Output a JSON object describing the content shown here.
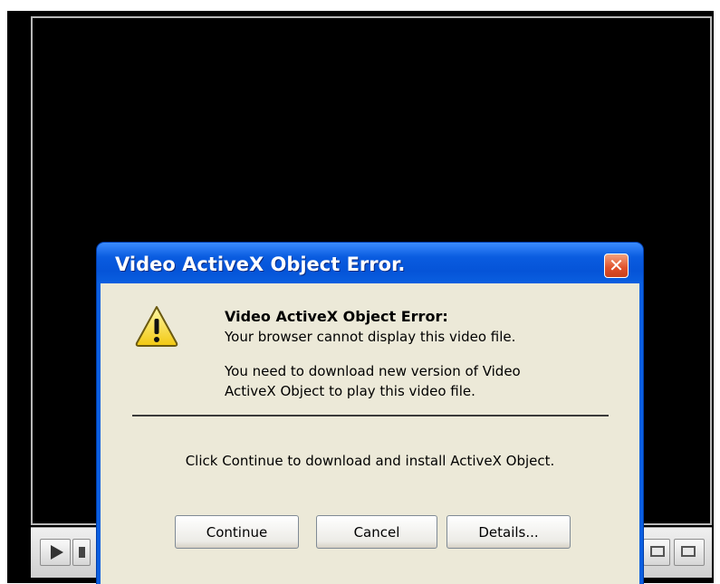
{
  "dialog": {
    "title": "Video ActiveX Object Error.",
    "close_glyph": "✕",
    "heading": "Video ActiveX Object Error:",
    "line1": "Your browser cannot display this video file.",
    "line2": "You need to download new version of Video",
    "line3": "ActiveX Object to play this video file.",
    "instruction": "Click Continue to download and install ActiveX Object.",
    "buttons": {
      "continue": "Continue",
      "cancel": "Cancel",
      "details": "Details..."
    },
    "icons": {
      "warning": "warning-icon",
      "close": "close-icon"
    }
  },
  "player": {
    "icons": [
      "play-icon",
      "stop-icon",
      "window-size-icon",
      "fullscreen-icon"
    ]
  },
  "colors": {
    "titlebar": "#0a5fe0",
    "dialog_background": "#ece9d8",
    "close_button": "#e0502a",
    "warning_yellow": "#ffe64a"
  }
}
